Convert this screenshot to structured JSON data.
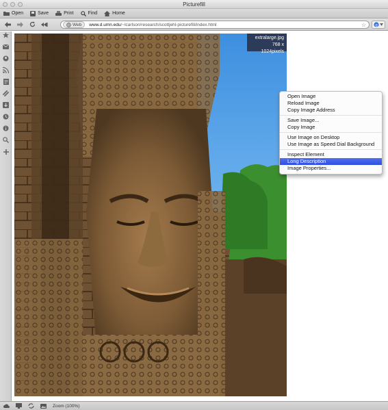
{
  "window": {
    "title": "Picturefill"
  },
  "toolbar": {
    "open": "Open",
    "save": "Save",
    "print": "Print",
    "find": "Find",
    "home": "Home"
  },
  "navigation": {
    "web_label": "Web",
    "url_host": "www.d.umn.edu",
    "url_path": "/~lcarlson/research/scottjehl-picturefill/index.html"
  },
  "image": {
    "filename": "extralarge.jpg",
    "dimensions": "768 x 1024pixels"
  },
  "context_menu": {
    "groups": [
      [
        "Open Image",
        "Reload Image",
        "Copy Image Address"
      ],
      [
        "Save Image...",
        "Copy Image"
      ],
      [
        "Use Image on Desktop",
        "Use Image as Speed Dial Background"
      ],
      [
        "Inspect Element",
        "Long Description",
        "Image Properties..."
      ]
    ],
    "selected": "Long Description"
  },
  "statusbar": {
    "zoom": "Zoom (100%)"
  },
  "colors": {
    "selection": "#3355e6",
    "sky": "#4a9be4",
    "stone": "#7a5a34",
    "foliage": "#3c8f2e"
  }
}
